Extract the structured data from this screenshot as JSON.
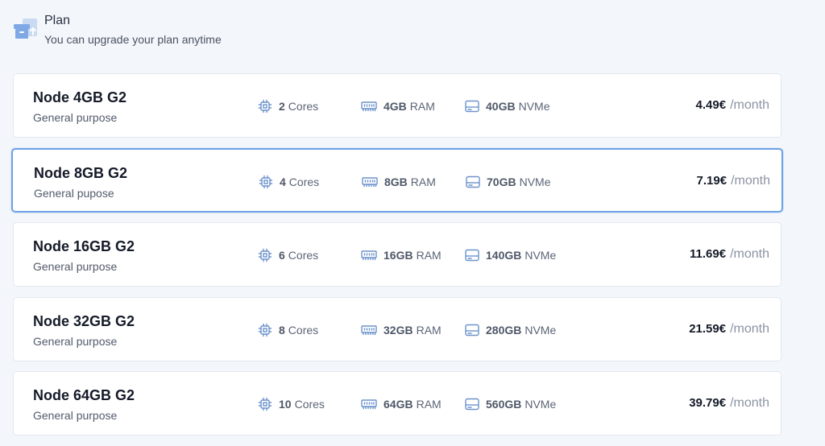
{
  "header": {
    "title": "Plan",
    "subtitle": "You can upgrade your plan anytime",
    "icon": "archive-box-icon"
  },
  "accent_color": "#6ea2e6",
  "plans": [
    {
      "name": "Node 4GB G2",
      "purpose": "General purpose",
      "cores": "2",
      "cores_label": "Cores",
      "ram": "4GB",
      "ram_label": "RAM",
      "disk": "40GB",
      "disk_label": "NVMe",
      "price": "4.49€",
      "period": "/month",
      "selected": false
    },
    {
      "name": "Node 8GB G2",
      "purpose": "General pupose",
      "cores": "4",
      "cores_label": "Cores",
      "ram": "8GB",
      "ram_label": "RAM",
      "disk": "70GB",
      "disk_label": "NVMe",
      "price": "7.19€",
      "period": "/month",
      "selected": true
    },
    {
      "name": "Node 16GB G2",
      "purpose": "General purpose",
      "cores": "6",
      "cores_label": "Cores",
      "ram": "16GB",
      "ram_label": "RAM",
      "disk": "140GB",
      "disk_label": "NVMe",
      "price": "11.69€",
      "period": "/month",
      "selected": false
    },
    {
      "name": "Node 32GB G2",
      "purpose": "General purpose",
      "cores": "8",
      "cores_label": "Cores",
      "ram": "32GB",
      "ram_label": "RAM",
      "disk": "280GB",
      "disk_label": "NVMe",
      "price": "21.59€",
      "period": "/month",
      "selected": false
    },
    {
      "name": "Node 64GB G2",
      "purpose": "General purpose",
      "cores": "10",
      "cores_label": "Cores",
      "ram": "64GB",
      "ram_label": "RAM",
      "disk": "560GB",
      "disk_label": "NVMe",
      "price": "39.79€",
      "period": "/month",
      "selected": false
    }
  ]
}
